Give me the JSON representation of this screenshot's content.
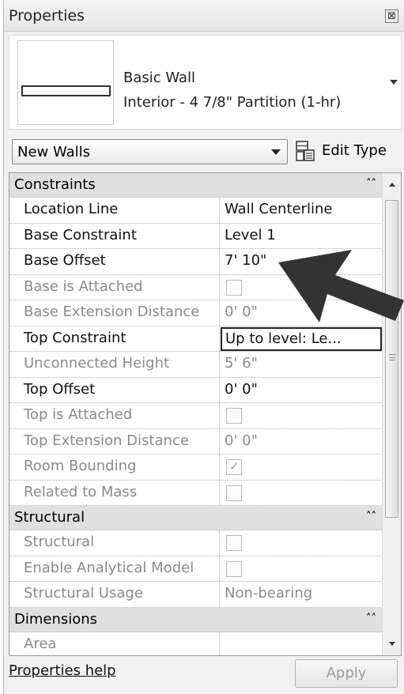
{
  "window": {
    "title": "Properties",
    "close_symbol": "⊠"
  },
  "type_selector": {
    "family": "Basic Wall",
    "type_name": "Interior - 4 7/8\" Partition (1-hr)"
  },
  "instance_filter": {
    "selected": "New Walls",
    "edit_type_label": "Edit Type"
  },
  "groups": {
    "constraints": {
      "label": "Constraints",
      "rows": [
        {
          "name": "Location Line",
          "value": "Wall Centerline"
        },
        {
          "name": "Base Constraint",
          "value": "Level 1"
        },
        {
          "name": "Base Offset",
          "value": "7'  10\""
        },
        {
          "name": "Base is Attached",
          "checked": false
        },
        {
          "name": "Base Extension Distance",
          "value": "0'  0\""
        },
        {
          "name": "Top Constraint",
          "value": "Up to level: Le..."
        },
        {
          "name": "Unconnected Height",
          "value": "5'  6\""
        },
        {
          "name": "Top Offset",
          "value": "0'  0\""
        },
        {
          "name": "Top is Attached",
          "checked": false
        },
        {
          "name": "Top Extension Distance",
          "value": "0'  0\""
        },
        {
          "name": "Room Bounding",
          "checked": true
        },
        {
          "name": "Related to Mass",
          "checked": false
        }
      ]
    },
    "structural": {
      "label": "Structural",
      "rows": [
        {
          "name": "Structural",
          "checked": false
        },
        {
          "name": "Enable Analytical Model",
          "checked": false
        },
        {
          "name": "Structural Usage",
          "value": "Non-bearing"
        }
      ]
    },
    "dimensions": {
      "label": "Dimensions",
      "rows": [
        {
          "name": "Area",
          "value": ""
        }
      ]
    }
  },
  "footer": {
    "help_link": "Properties help",
    "apply_label": "Apply"
  },
  "colors": {
    "annotation_arrow": "#333333",
    "group_header_bg": "#e0e0e0",
    "disabled_text": "#8a8a8a"
  },
  "icons": [
    "close-icon",
    "type-dropdown-arrow-icon",
    "dropdown-arrow-icon",
    "edit-type-icon",
    "collapse-chevron-icon",
    "annotation-arrow-icon"
  ]
}
